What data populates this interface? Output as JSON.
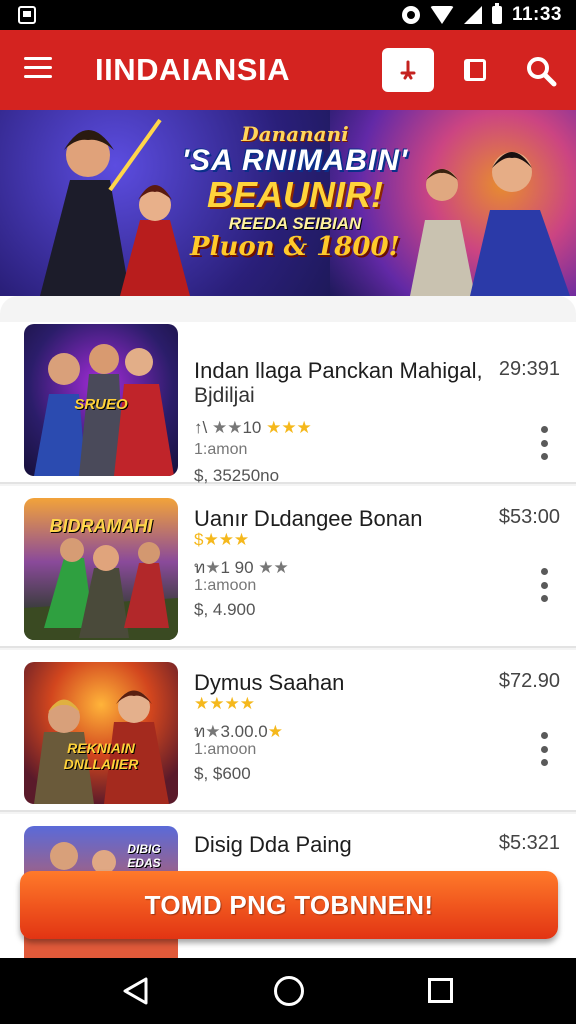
{
  "status_bar": {
    "time": "11:33",
    "icons": [
      "notification-icon",
      "data-saver-icon",
      "wifi-icon",
      "signal-icon",
      "battery-icon"
    ]
  },
  "app_bar": {
    "title": "IINDAIANSIA",
    "actions": [
      "menu-icon",
      "download-icon",
      "book-icon",
      "search-icon"
    ],
    "color": "#d42320"
  },
  "banner": {
    "line1": "Dananani",
    "line2": "'SA RNIMABIN'",
    "line3": "BEAUNIR!",
    "line4": "REEDA SEIBIAN",
    "line5": "Pluon & 1800!"
  },
  "items": [
    {
      "title": "Indan llaga Panckan Mahigal,",
      "subtitle": "Bjdiljai",
      "price": "29:391",
      "rating_prefix": "↑\\ ",
      "rating_gray": "★★",
      "rating_value": "10 ",
      "rating_gold": "★★★",
      "meta": "1:amon",
      "cost": "$, 35250no",
      "thumb_label": "SRUEO"
    },
    {
      "title": "Uanır Dւdangee Bonan",
      "subtitle": "",
      "price": "$53:00",
      "rating_line1": "$★★★",
      "rating_prefix": "ท",
      "rating_gray": "★",
      "rating_value": "1 90 ",
      "rating_gold2": "★★",
      "meta": "1:amoon",
      "cost": "$, 4.900",
      "thumb_label": "BIDRAMAHI"
    },
    {
      "title": "Dymus Saahan",
      "subtitle": "",
      "price": "$72.90",
      "rating_line1": "★★★★",
      "rating_prefix": "ท",
      "rating_gray": "★",
      "rating_value": "3.00.0",
      "rating_gold": "★",
      "meta": "1:amoon",
      "cost": "$, $600",
      "thumb_label": "REKNIAIN DNLLAIIER"
    },
    {
      "title": "Disig Dda Paing",
      "subtitle": "",
      "price": "$5:321",
      "thumb_label": "DIBIG EDAS"
    }
  ],
  "cta": {
    "label": "TOMD PNG TOBNNEN!"
  },
  "nav_bar": {
    "icons": [
      "back-icon",
      "home-icon",
      "recents-icon"
    ]
  }
}
